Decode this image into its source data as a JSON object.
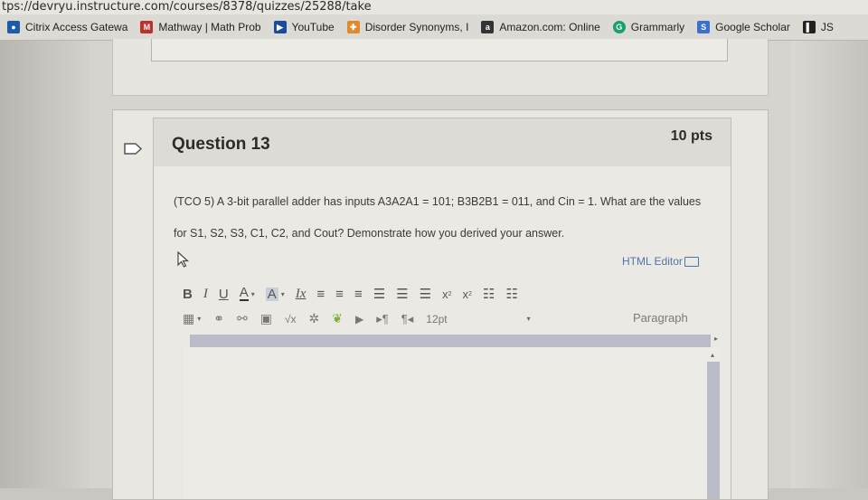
{
  "browser": {
    "url": "tps://devryu.instructure.com/courses/8378/quizzes/25288/take",
    "bookmarks": [
      {
        "label": "Citrix Access Gatewa",
        "icon": "citrix-icon",
        "color": "#1d5aa8"
      },
      {
        "label": "Mathway | Math Prob",
        "icon": "mathway-icon",
        "color": "#c0302a"
      },
      {
        "label": "YouTube",
        "icon": "youtube-icon",
        "color": "#1a4aa0"
      },
      {
        "label": "Disorder Synonyms, I",
        "icon": "thesaurus-icon",
        "color": "#e08a2a"
      },
      {
        "label": "Amazon.com: Online",
        "icon": "amazon-icon",
        "color": "#333333"
      },
      {
        "label": "Grammarly",
        "icon": "grammarly-icon",
        "color": "#15a36a"
      },
      {
        "label": "Google Scholar",
        "icon": "google-scholar-icon",
        "color": "#3a6fd8"
      },
      {
        "label": "JS",
        "icon": "js-icon",
        "color": "#222222"
      }
    ]
  },
  "question": {
    "title": "Question 13",
    "points": "10 pts",
    "text": "(TCO 5) A 3-bit parallel adder has inputs A3A2A1 = 101; B3B2B1 = 011, and Cin = 1. What are the values for S1, S2, S3, C1, C2, and Cout? Demonstrate how you derived your answer."
  },
  "editor": {
    "html_editor_label": "HTML Editor",
    "toolbar_row1": [
      "B",
      "I",
      "U",
      "A",
      "A",
      "Ix"
    ],
    "font_size": "12pt",
    "paragraph": "Paragraph",
    "pilcrow_ltr": "▸¶",
    "pilcrow_rtl": "¶◂"
  },
  "colors": {
    "link": "#4f74a8",
    "scrollbar": "#b9bcc6"
  }
}
